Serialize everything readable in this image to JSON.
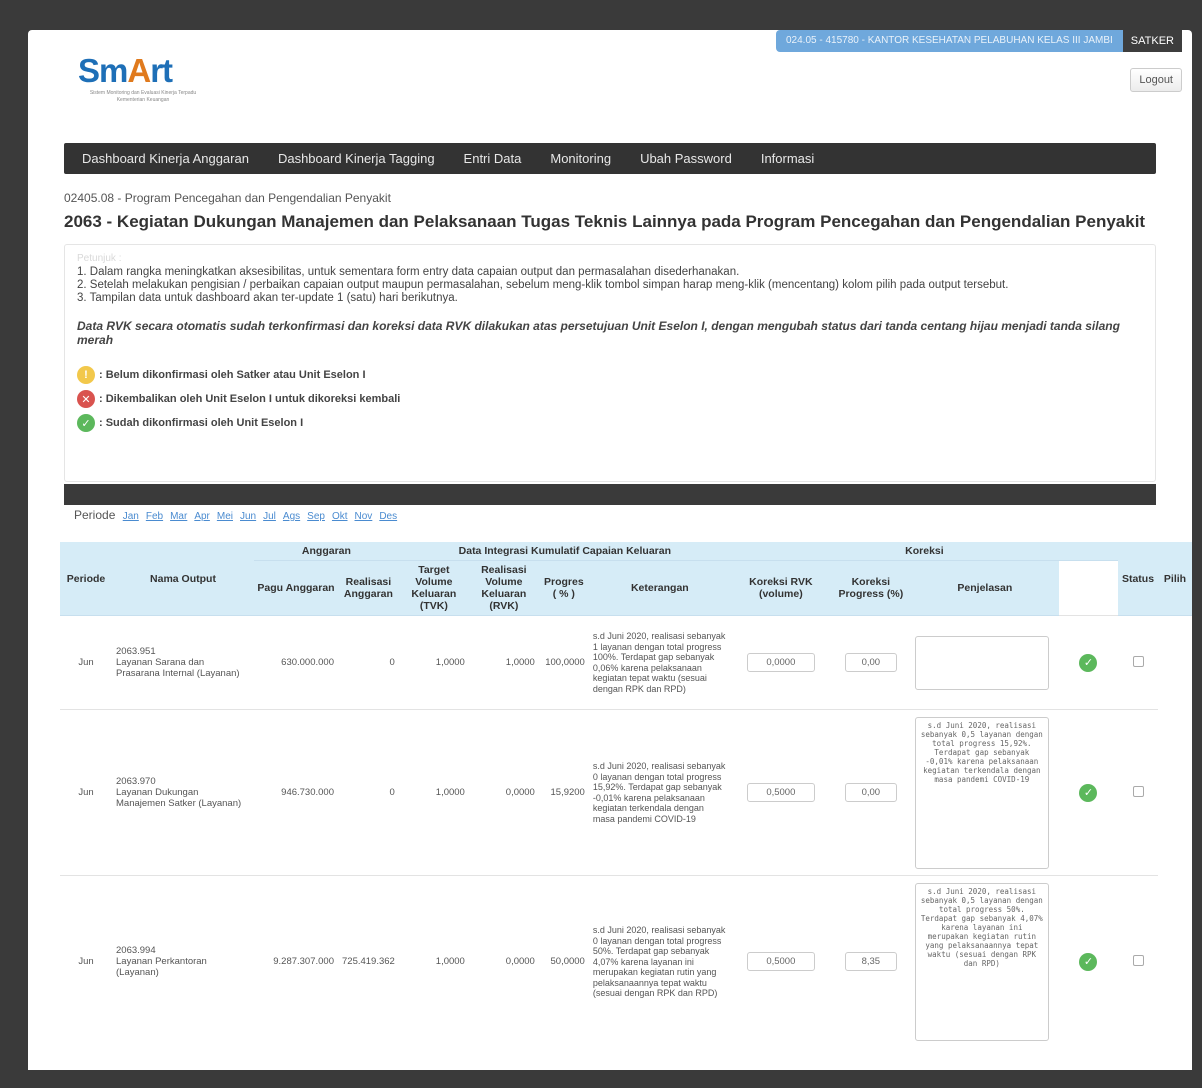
{
  "header": {
    "satker_info": "024.05 - 415780 - KANTOR KESEHATAN PELABUHAN KELAS III JAMBI",
    "role": "SATKER",
    "logout_label": "Logout",
    "logo_main": "SmArt",
    "logo_sub": "Sistem Monitoring dan Evaluasi Kinerja Terpadu Kementerian Keuangan"
  },
  "nav": {
    "items": [
      "Dashboard Kinerja Anggaran",
      "Dashboard Kinerja Tagging",
      "Entri Data",
      "Monitoring",
      "Ubah Password",
      "Informasi"
    ]
  },
  "program": {
    "line": "02405.08 - Program Pencegahan dan Pengendalian Penyakit",
    "title": "2063 - Kegiatan Dukungan Manajemen dan Pelaksanaan Tugas Teknis Lainnya pada Program Pencegahan dan Pengendalian Penyakit"
  },
  "notice": {
    "heading": "Petunjuk :",
    "lines": [
      "1. Dalam rangka meningkatkan aksesibilitas, untuk sementara form entry data capaian output dan permasalahan disederhanakan.",
      "2. Setelah melakukan pengisian / perbaikan capaian output maupun permasalahan, sebelum meng-klik tombol simpan harap meng-klik (mencentang) kolom pilih pada output tersebut.",
      "3. Tampilan data untuk dashboard akan ter-update 1 (satu) hari berikutnya."
    ],
    "strong": "Data RVK secara otomatis sudah terkonfirmasi dan koreksi data RVK dilakukan atas persetujuan Unit Eselon I, dengan mengubah status dari tanda centang hijau menjadi tanda silang merah",
    "legend": [
      {
        "icon": "warning-icon",
        "symbol": "!",
        "text": ": Belum dikonfirmasi oleh Satker atau Unit Eselon I"
      },
      {
        "icon": "returned-icon",
        "symbol": "✕",
        "text": ": Dikembalikan oleh Unit Eselon I untuk dikoreksi kembali"
      },
      {
        "icon": "confirmed-icon",
        "symbol": "✓",
        "text": ": Sudah dikonfirmasi oleh Unit Eselon I"
      }
    ]
  },
  "periode": {
    "label": "Periode",
    "months": [
      "Jan",
      "Feb",
      "Mar",
      "Apr",
      "Mei",
      "Jun",
      "Jul",
      "Ags",
      "Sep",
      "Okt",
      "Nov",
      "Des"
    ]
  },
  "table": {
    "group_headers": {
      "anggaran": "Anggaran",
      "integrasi": "Data Integrasi Kumulatif Capaian Keluaran",
      "koreksi": "Koreksi"
    },
    "headers": {
      "periode": "Periode",
      "nama_output": "Nama Output",
      "pagu": "Pagu Anggaran",
      "realisasi": "Realisasi Anggaran",
      "tvk": "Target Volume Keluaran (TVK)",
      "rvk": "Realisasi Volume Keluaran (RVK)",
      "progres": "Progres ( % )",
      "keterangan": "Keterangan",
      "koreksi_rvk": "Koreksi RVK (volume)",
      "koreksi_progress": "Koreksi Progress (%)",
      "penjelasan": "Penjelasan",
      "status": "Status",
      "pilih": "Pilih"
    },
    "rows": [
      {
        "periode": "Jun",
        "code": "2063.951",
        "name": "Layanan Sarana dan Prasarana Internal (Layanan)",
        "pagu": "630.000.000",
        "realisasi": "0",
        "tvk": "1,0000",
        "rvk": "1,0000",
        "progres": "100,0000",
        "keterangan": "s.d Juni 2020, realisasi sebanyak 1 layanan dengan total progress 100%. Terdapat gap sebanyak 0,06% karena pelaksanaan kegiatan tepat waktu (sesuai dengan RPK dan RPD)",
        "koreksi_rvk": "0,0000",
        "koreksi_progress": "0,00",
        "penjelasan": ""
      },
      {
        "periode": "Jun",
        "code": "2063.970",
        "name": "Layanan Dukungan Manajemen Satker (Layanan)",
        "pagu": "946.730.000",
        "realisasi": "0",
        "tvk": "1,0000",
        "rvk": "0,0000",
        "progres": "15,9200",
        "keterangan": "s.d Juni 2020, realisasi sebanyak 0 layanan dengan total progress 15,92%. Terdapat gap sebanyak -0,01% karena pelaksanaan kegiatan terkendala dengan masa pandemi COVID-19",
        "koreksi_rvk": "0,5000",
        "koreksi_progress": "0,00",
        "penjelasan": "s.d Juni 2020, realisasi sebanyak 0,5 layanan dengan total progress 15,92%. Terdapat gap sebanyak -0,01% karena pelaksanaan kegiatan terkendala dengan masa pandemi COVID-19"
      },
      {
        "periode": "Jun",
        "code": "2063.994",
        "name": "Layanan Perkantoran (Layanan)",
        "pagu": "9.287.307.000",
        "realisasi": "725.419.362",
        "tvk": "1,0000",
        "rvk": "0,0000",
        "progres": "50,0000",
        "keterangan": "s.d Juni 2020, realisasi sebanyak 0 layanan dengan total progress 50%. Terdapat gap sebanyak 4,07% karena layanan ini merupakan kegiatan rutin yang pelaksanaannya tepat waktu (sesuai dengan RPK dan RPD)",
        "koreksi_rvk": "0,5000",
        "koreksi_progress": "8,35",
        "penjelasan": "s.d Juni 2020, realisasi sebanyak 0,5 layanan dengan total progress 50%. Terdapat gap sebanyak 4,07% karena layanan ini merupakan kegiatan rutin yang pelaksanaannya tepat waktu (sesuai dengan RPK dan RPD)"
      }
    ],
    "status_icon": "confirmed-icon",
    "status_symbol": "✓"
  },
  "colors": {
    "navbar": "#333333",
    "header_blue": "#6fa8dc",
    "table_head": "#d6ecf7",
    "ok_green": "#5cb85c",
    "warn_yellow": "#f2c84b",
    "ret_red": "#d9534f",
    "logo_blue": "#1e6fb7",
    "logo_orange": "#e07a1d"
  }
}
